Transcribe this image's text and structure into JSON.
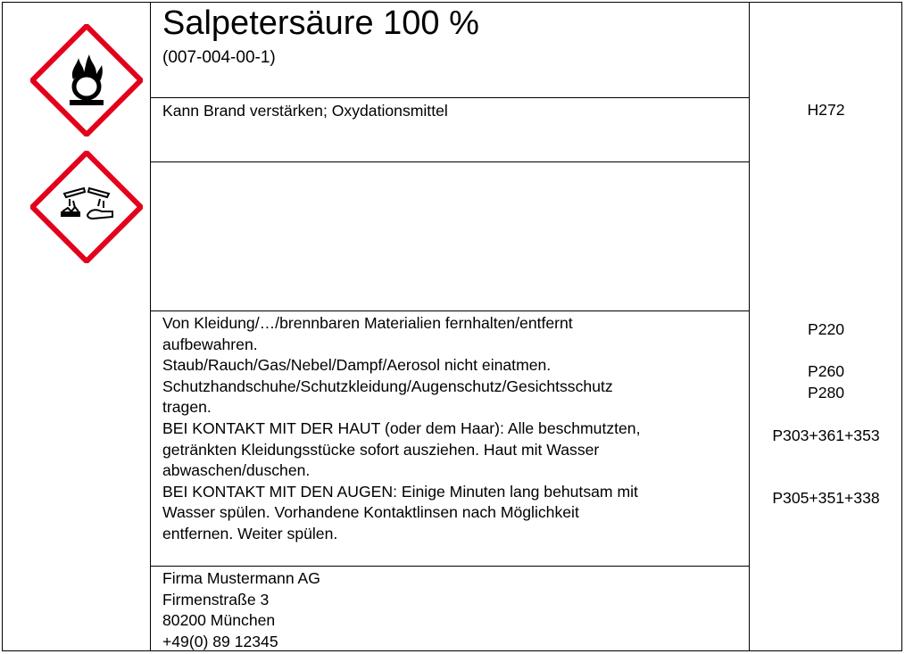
{
  "product": {
    "name": "Salpetersäure 100 %",
    "index_number": "(007-004-00-1)"
  },
  "pictograms": [
    {
      "icon": "flame-over-circle-icon",
      "border_color": "#e3001b"
    },
    {
      "icon": "corrosion-icon",
      "border_color": "#e3001b"
    }
  ],
  "hazard": {
    "text": "Kann Brand verstärken; Oxydationsmittel",
    "code": "H272"
  },
  "precautionary": {
    "lines": [
      "Von Kleidung/…/brennbaren Materialien fernhalten/entfernt",
      "aufbewahren.",
      "Staub/Rauch/Gas/Nebel/Dampf/Aerosol nicht einatmen.",
      "Schutzhandschuhe/Schutzkleidung/Augenschutz/Gesichtsschutz",
      "tragen.",
      "BEI KONTAKT MIT DER HAUT (oder dem Haar): Alle beschmutzten,",
      "getränkten Kleidungsstücke sofort ausziehen. Haut mit Wasser",
      "abwaschen/duschen.",
      "BEI KONTAKT MIT DEN AUGEN: Einige Minuten lang behutsam mit",
      "Wasser spülen. Vorhandene Kontaktlinsen nach Möglichkeit",
      "entfernen. Weiter spülen."
    ],
    "codes": [
      "P220",
      "P260",
      "P280",
      "P303+361+353",
      "P305+351+338"
    ]
  },
  "supplier": {
    "lines": [
      "Firma Mustermann AG",
      "Firmenstraße 3",
      "80200 München",
      "+49(0) 89 12345"
    ]
  }
}
